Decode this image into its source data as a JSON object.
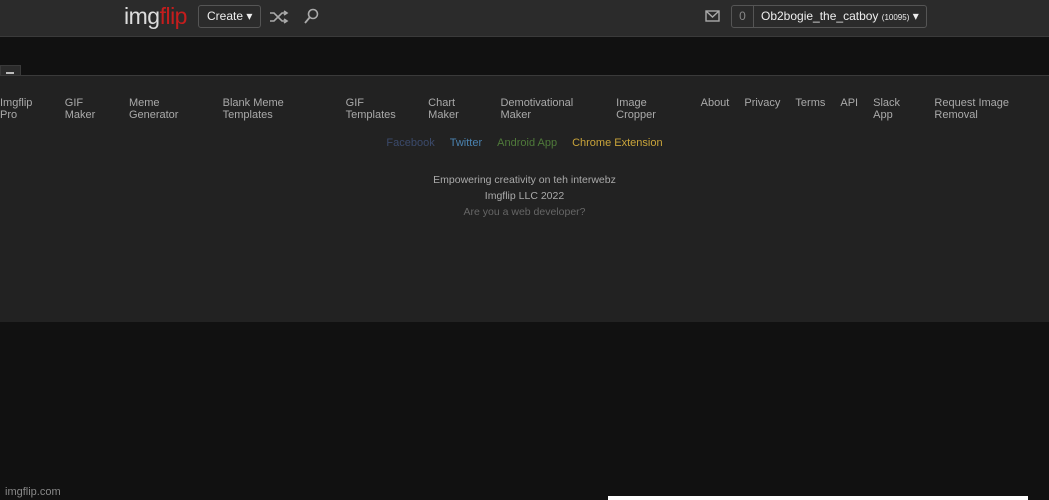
{
  "header": {
    "logo_a": "img",
    "logo_b": "flip",
    "create_label": "Create ▾",
    "shuffle_icon": "shuffle-icon",
    "search_icon": "search-icon",
    "mail_icon": "mail-icon",
    "notif_count": "0",
    "username": "Ob2bogie_the_catboy",
    "points": "(10095)",
    "user_caret": "▾"
  },
  "footer": {
    "links": [
      "Imgflip Pro",
      "GIF Maker",
      "Meme Generator",
      "Blank Meme Templates",
      "GIF Templates",
      "Chart Maker",
      "Demotivational Maker",
      "Image Cropper",
      "About",
      "Privacy",
      "Terms",
      "API",
      "Slack App",
      "Request Image Removal"
    ],
    "social": [
      {
        "label": "Facebook",
        "color": "#3b4a6b"
      },
      {
        "label": "Twitter",
        "color": "#4a82b0"
      },
      {
        "label": "Android App",
        "color": "#4f7a3a"
      },
      {
        "label": "Chrome Extension",
        "color": "#c9a43a"
      }
    ],
    "tagline": "Empowering creativity on teh interwebz",
    "copyright": "Imgflip LLC 2022",
    "developer": "Are you a web developer?"
  },
  "watermark": "imgflip.com"
}
